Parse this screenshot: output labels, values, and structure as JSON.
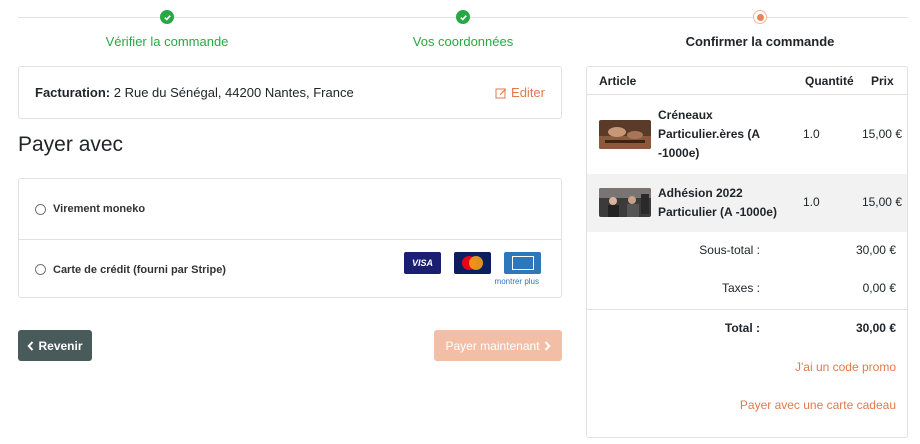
{
  "steps": [
    {
      "label": "Vérifier la commande",
      "state": "done"
    },
    {
      "label": "Vos coordonnées",
      "state": "done"
    },
    {
      "label": "Confirmer la commande",
      "state": "current"
    }
  ],
  "billing": {
    "label": "Facturation:",
    "address": "2 Rue du Sénégal, 44200 Nantes, France",
    "edit_label": "Editer"
  },
  "payment": {
    "title": "Payer avec",
    "methods": [
      {
        "label": "Virement moneko"
      },
      {
        "label": "Carte de crédit (fourni par Stripe)"
      }
    ],
    "cards": {
      "visa": "VISA",
      "more_label": "montrer plus"
    }
  },
  "buttons": {
    "back_label": "Revenir",
    "pay_label": "Payer maintenant"
  },
  "summary": {
    "headers": {
      "article": "Article",
      "quantity": "Quantité",
      "price": "Prix"
    },
    "items": [
      {
        "name": "Créneaux Particulier.ères (A -1000e)",
        "qty": "1.0",
        "price": "15,00 €"
      },
      {
        "name": "Adhésion 2022 Particulier (A -1000e)",
        "qty": "1.0",
        "price": "15,00 €"
      }
    ],
    "subtotal_label": "Sous-total :",
    "subtotal_value": "30,00 €",
    "taxes_label": "Taxes :",
    "taxes_value": "0,00 €",
    "total_label": "Total :",
    "total_value": "30,00 €",
    "promo_link": "J'ai un code promo",
    "gift_link": "Payer avec une carte cadeau"
  },
  "colors": {
    "accent": "#e07a4c",
    "success": "#28a745",
    "back_button": "#495a5a",
    "pay_button": "#f2bfa6"
  }
}
